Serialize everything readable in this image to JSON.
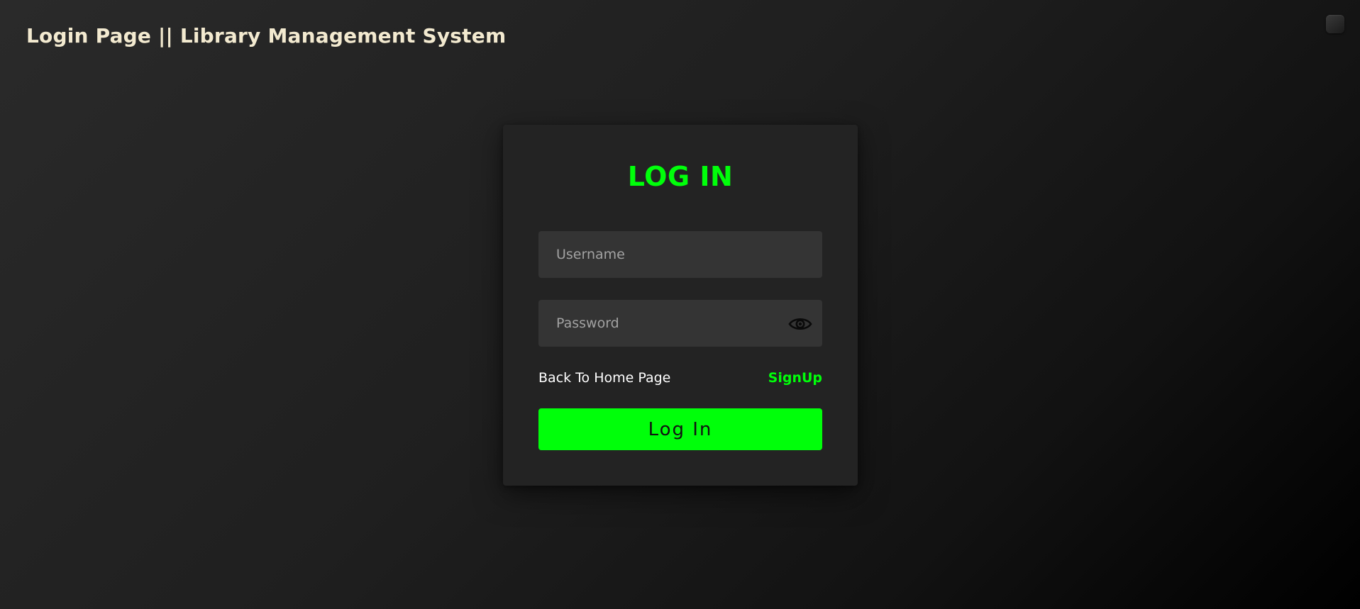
{
  "header": {
    "title": "Login Page || Library Management System"
  },
  "card": {
    "title": "LOG IN",
    "username": {
      "placeholder": "Username",
      "value": ""
    },
    "password": {
      "placeholder": "Password",
      "value": "",
      "toggle_icon": "eye-icon"
    },
    "back_link": "Back To Home Page",
    "signup_link": "SignUp",
    "submit_label": "Log In"
  },
  "colors": {
    "accent": "#00ff0a",
    "card_background": "#232323",
    "input_background": "#343434",
    "heading_text": "#f3ead0"
  }
}
